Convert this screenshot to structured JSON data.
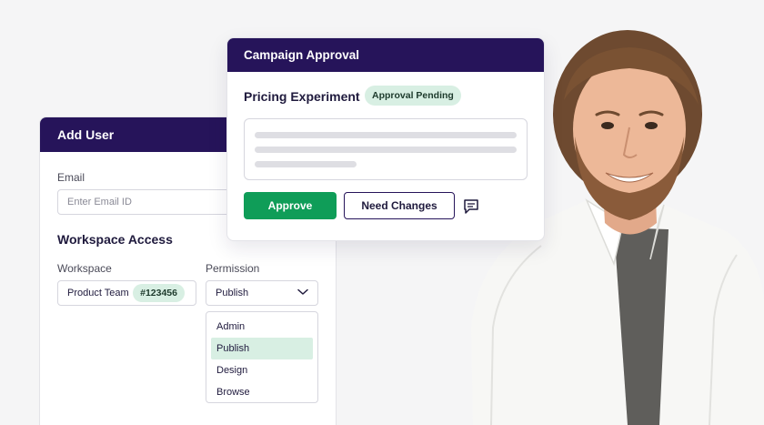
{
  "add_user": {
    "title": "Add User",
    "email_label": "Email",
    "email_placeholder": "Enter Email ID",
    "workspace_access_title": "Workspace Access",
    "workspace_label": "Workspace",
    "permission_label": "Permission",
    "workspace_value": "Product Team",
    "workspace_id": "#123456",
    "permission_value": "Publish",
    "permission_options": [
      "Admin",
      "Publish",
      "Design",
      "Browse"
    ],
    "selected_option": "Publish"
  },
  "approval": {
    "title": "Campaign Approval",
    "experiment_title": "Pricing Experiment",
    "status": "Approval Pending",
    "approve_label": "Approve",
    "changes_label": "Need Changes"
  },
  "icons": [
    "chevron-down-icon",
    "comment-icon"
  ],
  "colors": {
    "header": "#26145a",
    "approve": "#0f9d58",
    "badge_bg": "#d8efe3",
    "background": "#f5f5f6"
  }
}
